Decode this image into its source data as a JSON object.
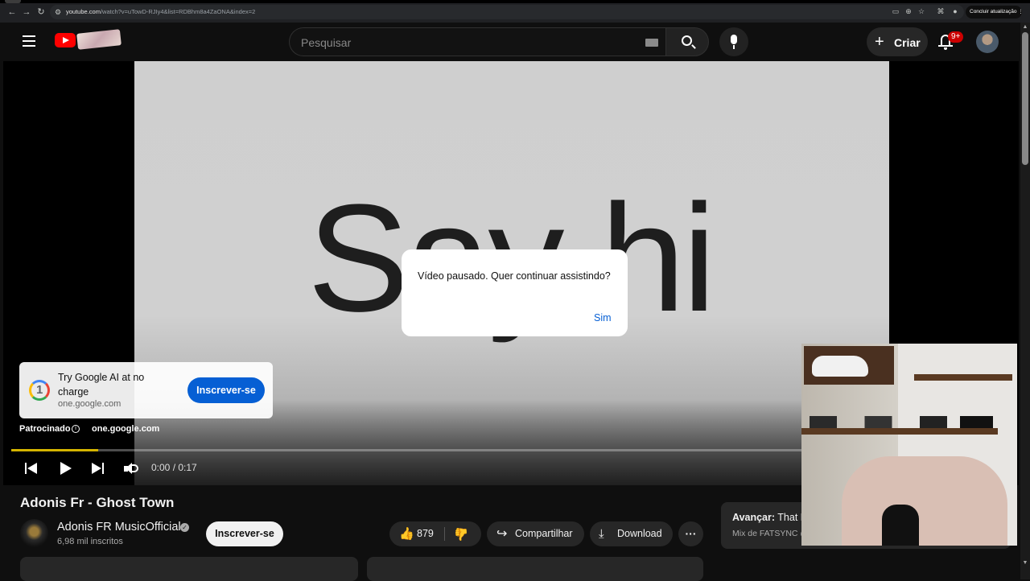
{
  "browser": {
    "url_host": "youtube.com",
    "url_path": "/watch?v=uTowD-RJIy4&list=RDBhm8a4ZaONA&index=2",
    "update_button": "Concluir atualização"
  },
  "header": {
    "search_placeholder": "Pesquisar",
    "create_label": "Criar",
    "notification_badge": "9+"
  },
  "player": {
    "video_text": "Say hi",
    "time": "0:00 / 0:17",
    "progress_buffer_fraction": 0.11
  },
  "ad": {
    "title": "Try Google AI at no charge",
    "domain": "one.google.com",
    "button": "Inscrever-se",
    "sponsored_label": "Patrocinado",
    "sponsored_url": "one.google.com",
    "logo_glyph": "1"
  },
  "dialog": {
    "message": "Vídeo pausado. Quer continuar assistindo?",
    "confirm": "Sim"
  },
  "video": {
    "title": "Adonis Fr - Ghost Town",
    "channel": "Adonis FR MusicOfficial",
    "subscribers": "6,98 mil inscritos",
    "subscribe_button": "Inscrever-se",
    "likes": "879",
    "share_label": "Compartilhar",
    "download_label": "Download",
    "more_label": "···"
  },
  "up_next": {
    "label": "Avançar:",
    "title": "That B",
    "subtitle": "Mix de FATSYNC @"
  },
  "icons": {
    "back": "←",
    "forward": "→",
    "reload": "↻",
    "like": "👍",
    "share": "↪",
    "download": "⤓",
    "plus": "+"
  },
  "colors": {
    "brand_red": "#ff0000",
    "link_blue": "#065fd4",
    "badge_red": "#cc0000",
    "progress_yellow": "#d4b400"
  }
}
